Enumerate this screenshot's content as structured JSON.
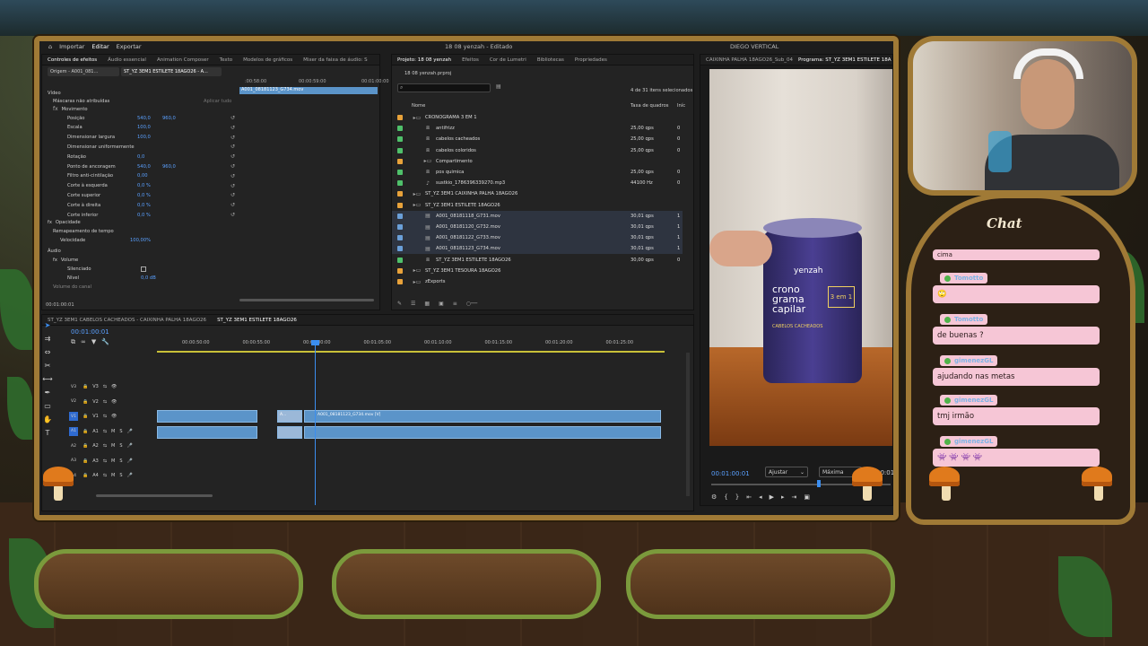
{
  "menubar": {
    "items": [
      "Importar",
      "Editar",
      "Exportar"
    ],
    "active": "Editar",
    "project_title": "18 08 yenzah - Editado",
    "workspace": "DIEGO VERTICAL"
  },
  "effects_panel": {
    "tabs": [
      "Controles de efeitos",
      "Áudio essencial",
      "Animation Composer",
      "Texto",
      "Modelos de gráficos",
      "Mixer da faixa de áudio: S"
    ],
    "source": "Origem - A001_081…",
    "sequence": "ST_YZ 3EM1 ESTILETE 18AGO26 - A...",
    "time_start": "00:01:00:00",
    "time_mid1": ":00:58:00",
    "time_mid2": "00:00:59:00",
    "clip_label": "A001_08181123_G734.mov",
    "header_video": "Vídeo",
    "masks": "Máscaras não atribuídas",
    "apply_all": "Aplicar tudo",
    "motion": "Movimento",
    "props": [
      {
        "label": "Posição",
        "v1": "540,0",
        "v2": "960,0"
      },
      {
        "label": "Escala",
        "v1": "100,0",
        "v2": ""
      },
      {
        "label": "Dimensionar largura",
        "v1": "100,0",
        "v2": ""
      },
      {
        "label": "Dimensionar uniformemente",
        "v1": "",
        "v2": ""
      },
      {
        "label": "Rotação",
        "v1": "0,0",
        "v2": ""
      },
      {
        "label": "Ponto de ancoragem",
        "v1": "540,0",
        "v2": "960,0"
      },
      {
        "label": "Filtro anti-cintilação",
        "v1": "0,00",
        "v2": ""
      },
      {
        "label": "Corte à esquerda",
        "v1": "0,0 %",
        "v2": ""
      },
      {
        "label": "Corte superior",
        "v1": "0,0 %",
        "v2": ""
      },
      {
        "label": "Corte à direita",
        "v1": "0,0 %",
        "v2": ""
      },
      {
        "label": "Corte inferior",
        "v1": "0,0 %",
        "v2": ""
      }
    ],
    "opacity": "Opacidade",
    "remap": "Remapeamento de tempo",
    "speed_label": "Velocidade",
    "speed": "100,00%",
    "audio": "Áudio",
    "volume": "Volume",
    "mute": "Silenciado",
    "level_label": "Nível",
    "level": "0,0 dB",
    "volume_mix": "Volume do canal",
    "timecode": "00:01:00:01"
  },
  "project_panel": {
    "tabs": [
      "Projeto: 18 08 yenzah",
      "Efeitos",
      "Cor de Lumetri",
      "Bibliotecas",
      "Propriedades"
    ],
    "file": "18 08 yenzah.prproj",
    "selection": "4 de 31 itens selecionados",
    "col_name": "Nome",
    "col_rate": "Taxa de quadros",
    "col_in": "Iníc",
    "items": [
      {
        "name": "CRONOGRAMA 3 EM 1",
        "rate": "",
        "in": "",
        "color": "#e8a23a",
        "type": "folder",
        "indent": 0
      },
      {
        "name": "antifrizz",
        "rate": "25,00 qps",
        "in": "0",
        "color": "#4fc06a",
        "type": "seq",
        "indent": 1
      },
      {
        "name": "cabelos cacheados",
        "rate": "25,00 qps",
        "in": "0",
        "color": "#4fc06a",
        "type": "seq",
        "indent": 1
      },
      {
        "name": "cabelos coloridos",
        "rate": "25,00 qps",
        "in": "0",
        "color": "#4fc06a",
        "type": "seq",
        "indent": 1
      },
      {
        "name": "Compartimento",
        "rate": "",
        "in": "",
        "color": "#e8a23a",
        "type": "folder",
        "indent": 1
      },
      {
        "name": "pos química",
        "rate": "25,00 qps",
        "in": "0",
        "color": "#4fc06a",
        "type": "seq",
        "indent": 1
      },
      {
        "name": "sustkio_1786396339270.mp3",
        "rate": "44100 Hz",
        "in": "0",
        "color": "#4fc06a",
        "type": "audio",
        "indent": 1
      },
      {
        "name": "ST_YZ 3EM1 CAIXINHA PALHA 18AGO26",
        "rate": "",
        "in": "",
        "color": "#e8a23a",
        "type": "folder",
        "indent": 0
      },
      {
        "name": "ST_YZ 3EM1 ESTILETE 18AGO26",
        "rate": "",
        "in": "",
        "color": "#e8a23a",
        "type": "folder",
        "indent": 0
      },
      {
        "name": "A001_08181118_G731.mov",
        "rate": "30,01 qps",
        "in": "1",
        "color": "#6a9fd8",
        "type": "clip",
        "indent": 1
      },
      {
        "name": "A001_08181120_G732.mov",
        "rate": "30,01 qps",
        "in": "1",
        "color": "#6a9fd8",
        "type": "clip",
        "indent": 1
      },
      {
        "name": "A001_08181122_G733.mov",
        "rate": "30,01 qps",
        "in": "1",
        "color": "#6a9fd8",
        "type": "clip",
        "indent": 1
      },
      {
        "name": "A001_08181123_G734.mov",
        "rate": "30,01 qps",
        "in": "1",
        "color": "#6a9fd8",
        "type": "clip",
        "indent": 1
      },
      {
        "name": "ST_YZ 3EM1 ESTILETE 18AGO26",
        "rate": "30,00 qps",
        "in": "0",
        "color": "#4fc06a",
        "type": "seq",
        "indent": 1
      },
      {
        "name": "ST_YZ 3EM1 TESOURA 18AGO26",
        "rate": "",
        "in": "",
        "color": "#e8a23a",
        "type": "folder",
        "indent": 0
      },
      {
        "name": "zExports",
        "rate": "",
        "in": "",
        "color": "#e8a23a",
        "type": "folder",
        "indent": 0
      }
    ]
  },
  "program_monitor": {
    "source_tab": "CAIXINHA PALHA 18AGO26_Sub_04",
    "program_tab": "Programa: ST_YZ 3EM1 ESTILETE 18A",
    "timecode": "00:01:00:01",
    "fit": "Ajustar",
    "quality": "Máxima",
    "timecode_right": "00:01",
    "product_brand": "yenzah",
    "product_text": "crono grama capilar",
    "product_badge": "3 em 1",
    "product_sub": "CABELOS CACHEADOS"
  },
  "timeline": {
    "tabs": [
      "ST_YZ 3EM1 CABELOS CACHEADOS - CAIXINHA PALHA 18AGO26",
      "ST_YZ 3EM1 ESTILETE 18AGO26"
    ],
    "timecode": "00:01:00:01",
    "ruler": [
      "00:00:50:00",
      "00:00:55:00",
      "00:01:00:00",
      "00:01:05:00",
      "00:01:10:00",
      "00:01:15:00",
      "00:01:20:00",
      "00:01:25:00"
    ],
    "video_tracks": [
      "V3",
      "V2",
      "V1"
    ],
    "audio_tracks": [
      "A1",
      "A2",
      "A3",
      "A4"
    ],
    "clip_name": "A001_08181123_G734.mov [V]",
    "clip_short": "A..."
  },
  "chat": {
    "title": "Chat",
    "messages": [
      {
        "user": "",
        "text": "cima"
      },
      {
        "user": "Tomotto",
        "text": "🙄"
      },
      {
        "user": "Tomotto",
        "text": "de buenas ?"
      },
      {
        "user": "gimenezGL",
        "text": "ajudando nas metas"
      },
      {
        "user": "gimenezGL",
        "text": "tmj irmão"
      },
      {
        "user": "gimenezGL",
        "text": "👾 👾 👾 👾"
      }
    ]
  }
}
